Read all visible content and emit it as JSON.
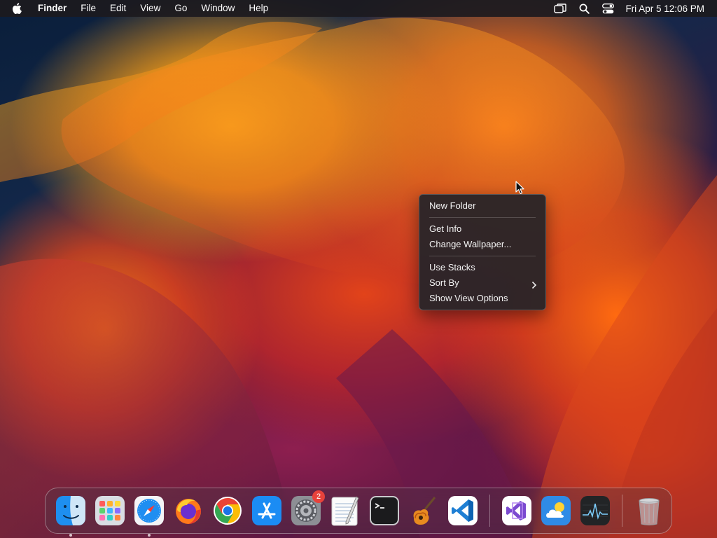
{
  "menubar": {
    "app_name": "Finder",
    "menus": [
      "File",
      "Edit",
      "View",
      "Go",
      "Window",
      "Help"
    ],
    "status_icons": [
      "screen-mirroring-icon",
      "spotlight-search-icon",
      "control-center-icon"
    ],
    "clock": "Fri Apr 5  12:06 PM"
  },
  "context_menu": {
    "items": [
      {
        "label": "New Folder"
      },
      {
        "label": "Get Info"
      },
      {
        "label": "Change Wallpaper..."
      },
      {
        "label": "Use Stacks"
      },
      {
        "label": "Sort By",
        "submenu": true
      },
      {
        "label": "Show View Options"
      }
    ]
  },
  "dock": {
    "apps": [
      {
        "name": "finder-icon",
        "running": true
      },
      {
        "name": "launchpad-icon",
        "running": false
      },
      {
        "name": "safari-icon",
        "running": true
      },
      {
        "name": "firefox-icon",
        "running": false
      },
      {
        "name": "chrome-icon",
        "running": false
      },
      {
        "name": "app-store-icon",
        "running": false
      },
      {
        "name": "system-settings-icon",
        "running": false,
        "badge": "2"
      },
      {
        "name": "textedit-icon",
        "running": false
      },
      {
        "name": "terminal-icon",
        "running": false
      },
      {
        "name": "garageband-icon",
        "running": false
      },
      {
        "name": "vscode-icon",
        "running": false
      },
      {
        "name": "visual-studio-icon",
        "running": false
      },
      {
        "name": "weather-icon",
        "running": false
      },
      {
        "name": "activity-monitor-icon",
        "running": false
      },
      {
        "name": "trash-icon",
        "running": false
      }
    ]
  },
  "colors": {
    "menubar_bg": "#1c1a1e",
    "menu_bg": "#262428",
    "badge": "#e8423b",
    "accent_orange": "#ff8a1c"
  }
}
